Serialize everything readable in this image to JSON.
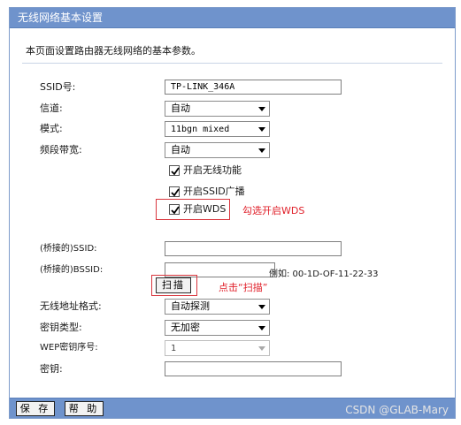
{
  "window": {
    "title": "无线网络基本设置"
  },
  "description": "本页面设置路由器无线网络的基本参数。",
  "fields": {
    "ssid": {
      "label": "SSID号:",
      "value": "TP-LINK_346A"
    },
    "channel": {
      "label": "信道:",
      "value": "自动"
    },
    "mode": {
      "label": "模式:",
      "value": "11bgn mixed"
    },
    "bandwidth": {
      "label": "频段带宽:",
      "value": "自动"
    },
    "bridged_ssid": {
      "label": "(桥接的)SSID:",
      "value": ""
    },
    "bridged_bssid": {
      "label": "(桥接的)BSSID:",
      "value": "",
      "example": "例如: 00-1D-OF-11-22-33"
    },
    "mac_format": {
      "label": "无线地址格式:",
      "value": "自动探测"
    },
    "key_type": {
      "label": "密钥类型:",
      "value": "无加密"
    },
    "wep_index": {
      "label": "WEP密钥序号:",
      "value": "1"
    },
    "key": {
      "label": "密钥:",
      "value": ""
    }
  },
  "checkboxes": {
    "enable_wireless": {
      "label": "开启无线功能",
      "checked": true
    },
    "ssid_broadcast": {
      "label": "开启SSID广播",
      "checked": true
    },
    "enable_wds": {
      "label": "开启WDS",
      "checked": true
    }
  },
  "buttons": {
    "scan": "扫描",
    "save": "保 存",
    "help": "帮 助"
  },
  "annotations": {
    "wds_hint": "勾选开启WDS",
    "scan_hint": "点击“扫描”",
    "color": "#e0202a"
  },
  "watermark": "CSDN @GLAB-Mary",
  "colors": {
    "title_bar": "#6f93cc",
    "accent_red": "#d9363e"
  }
}
